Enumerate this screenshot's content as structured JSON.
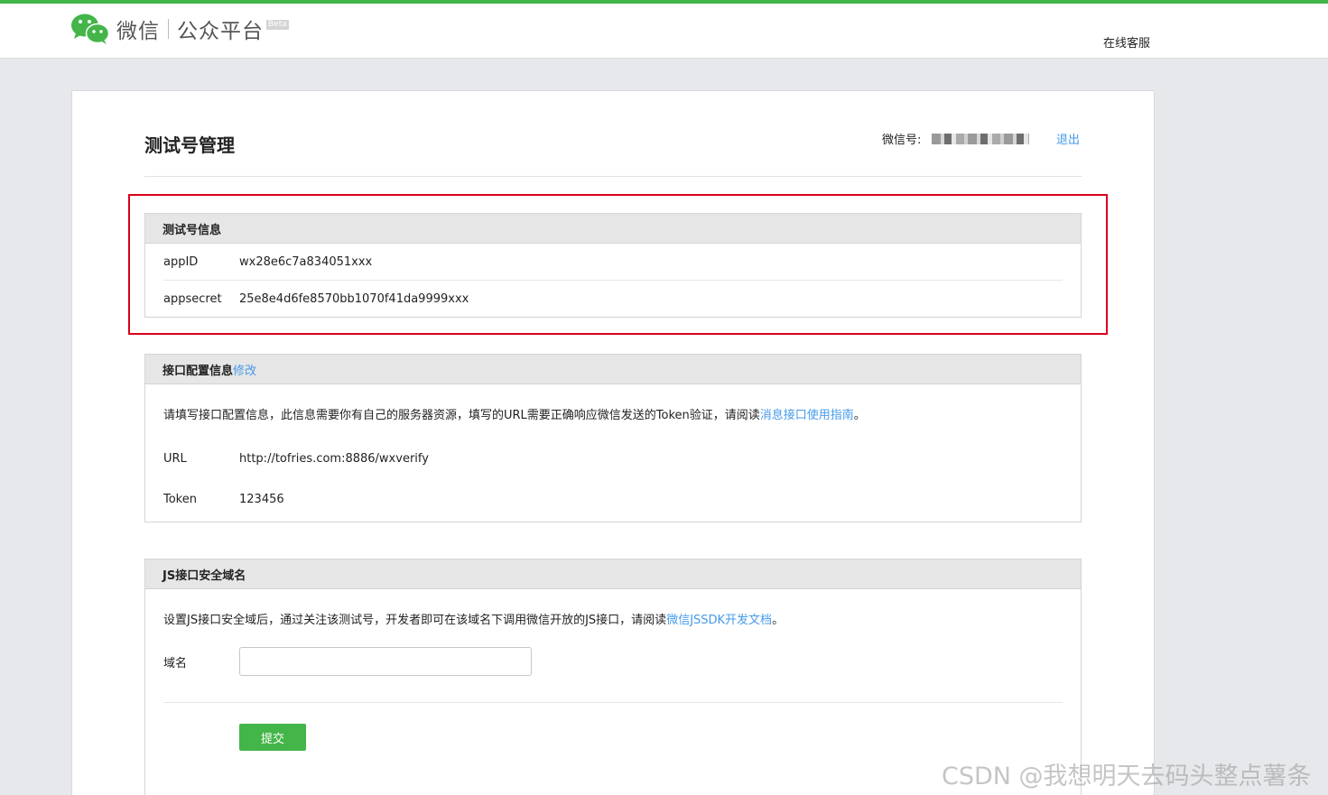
{
  "header": {
    "logo_text": "微信",
    "platform_name": "公众平台",
    "beta_label": "Beta",
    "service_link": "在线客服",
    "accent_color": "#44b549"
  },
  "page": {
    "title": "测试号管理",
    "account_label": "微信号:",
    "logout_label": "退出"
  },
  "test_account_panel": {
    "title": "测试号信息",
    "rows": [
      {
        "key": "appID",
        "value": "wx28e6c7a834051xxx"
      },
      {
        "key": "appsecret",
        "value": "25e8e4d6fe8570bb1070f41da9999xxx"
      }
    ]
  },
  "interface_panel": {
    "title": "接口配置信息",
    "edit_label": "修改",
    "description": "请填写接口配置信息，此信息需要你有自己的服务器资源，填写的URL需要正确响应微信发送的Token验证，请阅读",
    "guide_link": "消息接口使用指南",
    "description_end": "。",
    "url_key": "URL",
    "url_value": "http://tofries.com:8886/wxverify",
    "token_key": "Token",
    "token_value": "123456"
  },
  "js_panel": {
    "title": "JS接口安全域名",
    "description": "设置JS接口安全域后，通过关注该测试号，开发者即可在该域名下调用微信开放的JS接口，请阅读",
    "doc_link": "微信JSSDK开发文档",
    "description_end": "。",
    "domain_label": "域名",
    "domain_value": "",
    "submit_label": "提交"
  },
  "watermark": "CSDN @我想明天去码头整点薯条"
}
